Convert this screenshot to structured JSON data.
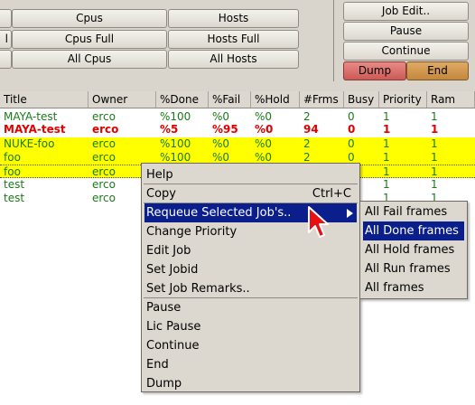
{
  "toolbar": {
    "row1": {
      "left_label": "",
      "cpus": "Cpus",
      "hosts": "Hosts"
    },
    "row2": {
      "left_label": "l",
      "cpus_full": "Cpus Full",
      "hosts_full": "Hosts Full"
    },
    "row3": {
      "left_label": "",
      "all_cpus": "All Cpus",
      "all_hosts": "All Hosts"
    }
  },
  "actions": {
    "job_edit": "Job Edit..",
    "pause": "Pause",
    "continue": "Continue",
    "dump": "Dump",
    "end": "End"
  },
  "colors": {
    "dump_button": "#d86a65",
    "end_button": "#d49a50",
    "row_highlight": "#ffff00",
    "ok_text": "#1a7a1a",
    "fail_text": "#e00000",
    "menu_highlight": "#0a1e8c"
  },
  "table": {
    "columns": [
      "Title",
      "Owner",
      "%Done",
      "%Fail",
      "%Hold",
      "#Frms",
      "Busy",
      "Priority",
      "Ram"
    ],
    "rows": [
      [
        "MAYA-test",
        "erco",
        "%100",
        "%0",
        "%0",
        "2",
        "0",
        "1",
        "1"
      ],
      [
        "MAYA-test",
        "erco",
        "%5",
        "%95",
        "%0",
        "94",
        "0",
        "1",
        "1"
      ],
      [
        "NUKE-foo",
        "erco",
        "%100",
        "%0",
        "%0",
        "2",
        "0",
        "1",
        "1"
      ],
      [
        "foo",
        "erco",
        "%100",
        "%0",
        "%0",
        "2",
        "0",
        "1",
        "1"
      ],
      [
        "foo",
        "erco",
        "",
        "",
        "",
        "",
        "",
        "1",
        "1"
      ],
      [
        "test",
        "erco",
        "",
        "",
        "",
        "",
        "",
        "1",
        "1"
      ],
      [
        "test",
        "erco",
        "",
        "",
        "",
        "",
        "",
        "1",
        "1"
      ]
    ]
  },
  "context_menu": {
    "items": [
      {
        "label": "Help"
      },
      {
        "label": "Copy",
        "shortcut": "Ctrl+C"
      },
      {
        "label": "Requeue Selected Job's..",
        "has_submenu": true
      },
      {
        "label": "Change Priority"
      },
      {
        "label": "Edit Job"
      },
      {
        "label": "Set Jobid"
      },
      {
        "label": "Set Job Remarks.."
      },
      {
        "label": "Pause"
      },
      {
        "label": "Lic Pause"
      },
      {
        "label": "Continue"
      },
      {
        "label": "End"
      },
      {
        "label": "Dump"
      }
    ]
  },
  "submenu": {
    "items": [
      "All Fail frames",
      "All Done frames",
      "All Hold frames",
      "All Run frames",
      "All frames"
    ]
  },
  "cursor_icon": "arrow-pointer-red"
}
